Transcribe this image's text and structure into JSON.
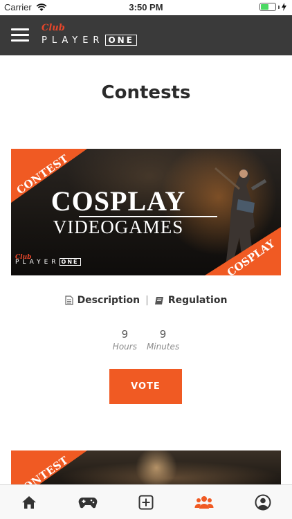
{
  "status_bar": {
    "carrier": "Carrier",
    "time": "3:50 PM",
    "battery_level": 0.55,
    "battery_color": "#4cd964"
  },
  "header": {
    "background": "#3a3a3a",
    "logo": {
      "script": "Club",
      "player": "PLAYER",
      "one": "ONE"
    },
    "menu_icon": "hamburger-icon"
  },
  "page": {
    "title": "Contests"
  },
  "contests": [
    {
      "corner_top": "CONTEST",
      "corner_bottom": "COSPLAY",
      "title": "COSPLAY",
      "subtitle": "VIDEOGAMES",
      "logo": {
        "script": "Club",
        "player": "PLAYER",
        "one": "ONE"
      },
      "links": {
        "description": "Description",
        "description_icon": "document-icon",
        "separator": "|",
        "regulation": "Regulation",
        "regulation_icon": "book-icon"
      },
      "countdown": {
        "hours": "9",
        "hours_label": "Hours",
        "minutes": "9",
        "minutes_label": "Minutes"
      },
      "vote_label": "VOTE"
    },
    {
      "corner_top": "CONTEST"
    }
  ],
  "accent_color": "#f05a23",
  "tab_bar": {
    "tabs": [
      {
        "icon": "home-icon",
        "active": false
      },
      {
        "icon": "gamepad-icon",
        "active": false
      },
      {
        "icon": "add-square-icon",
        "active": false
      },
      {
        "icon": "group-icon",
        "active": true
      },
      {
        "icon": "user-circle-icon",
        "active": false
      }
    ],
    "active_color": "#f05a23",
    "inactive_color": "#333333"
  }
}
